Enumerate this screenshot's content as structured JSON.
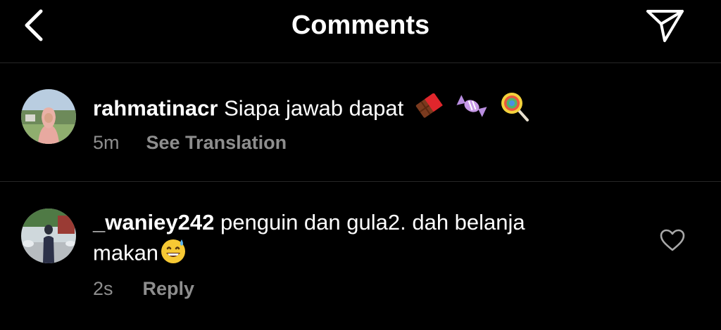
{
  "header": {
    "title": "Comments",
    "back_icon": "chevron-left-icon",
    "send_icon": "paper-plane-icon"
  },
  "comments": [
    {
      "username": "rahmatinacr",
      "text": "Siapa jawab dapat",
      "emojis": [
        "chocolate-bar-emoji",
        "candy-emoji",
        "lollipop-emoji"
      ],
      "time": "5m",
      "action": "See Translation"
    },
    {
      "username": "_waniey242",
      "text_line1": "penguin dan gula2. dah belanja",
      "text_line2": "makan",
      "emojis": [
        "grinning-sweat-emoji"
      ],
      "time": "2s",
      "action": "Reply",
      "like_icon": "heart-outline-icon"
    }
  ],
  "colors": {
    "background": "#000000",
    "text": "#ffffff",
    "secondary_text": "#8e8e8e",
    "divider": "#262626"
  }
}
